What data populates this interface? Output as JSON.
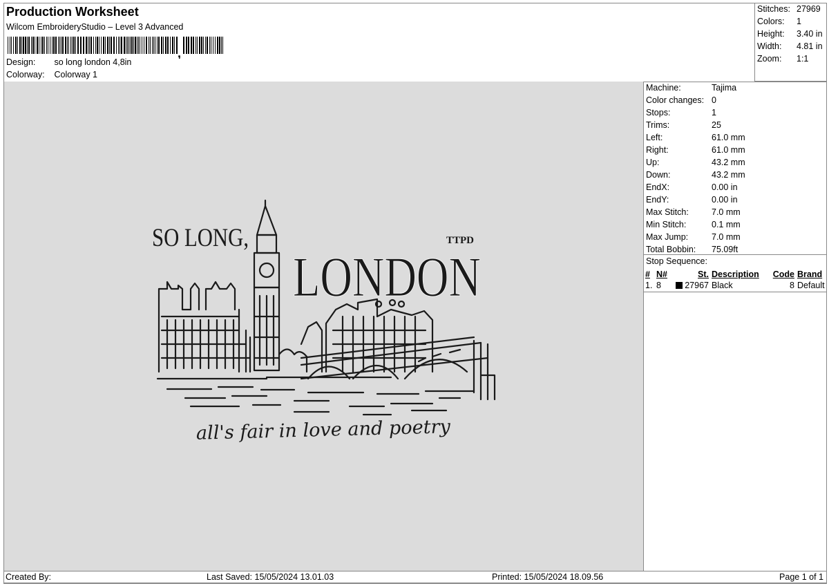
{
  "header": {
    "title": "Production Worksheet",
    "software": "Wilcom EmbroideryStudio – Level 3 Advanced",
    "design_label": "Design:",
    "design_value": "so long london 4,8in",
    "colorway_label": "Colorway:",
    "colorway_value": "Colorway 1"
  },
  "summary": {
    "stitches_label": "Stitches:",
    "stitches_value": "27969",
    "colors_label": "Colors:",
    "colors_value": "1",
    "height_label": "Height:",
    "height_value": "3.40 in",
    "width_label": "Width:",
    "width_value": "4.81 in",
    "zoom_label": "Zoom:",
    "zoom_value": "1:1"
  },
  "design_art": {
    "so_long": "SO LONG,",
    "london": "LONDON",
    "ttpd": "TTPD",
    "tagline": "all's fair in love and poetry",
    "thread_color": "#1a1a1a"
  },
  "machine": {
    "rows": [
      {
        "label": "Machine:",
        "value": "Tajima"
      },
      {
        "label": "Color changes:",
        "value": "0"
      },
      {
        "label": "Stops:",
        "value": "1"
      },
      {
        "label": "Trims:",
        "value": "25"
      },
      {
        "label": "Left:",
        "value": "61.0 mm"
      },
      {
        "label": "Right:",
        "value": "61.0 mm"
      },
      {
        "label": "Up:",
        "value": "43.2 mm"
      },
      {
        "label": "Down:",
        "value": "43.2 mm"
      },
      {
        "label": "EndX:",
        "value": "0.00 in"
      },
      {
        "label": "EndY:",
        "value": "0.00 in"
      },
      {
        "label": "Max Stitch:",
        "value": "7.0 mm"
      },
      {
        "label": "Min Stitch:",
        "value": "0.1 mm"
      },
      {
        "label": "Max Jump:",
        "value": "7.0 mm"
      },
      {
        "label": "Total Bobbin:",
        "value": "75.09ft"
      }
    ]
  },
  "stop_sequence": {
    "title": "Stop Sequence:",
    "columns": [
      "#",
      "N#",
      "St.",
      "Description",
      "Code",
      "Brand"
    ],
    "rows": [
      {
        "index": "1.",
        "n": "8",
        "swatch": "#000000",
        "stitches": "27967",
        "description": "Black",
        "code": "8",
        "brand": "Default"
      }
    ]
  },
  "footer": {
    "created_by": "Created By:",
    "last_saved": "Last Saved: 15/05/2024 13.01.03",
    "printed": "Printed: 15/05/2024 18.09.56",
    "page": "Page 1 of 1"
  }
}
